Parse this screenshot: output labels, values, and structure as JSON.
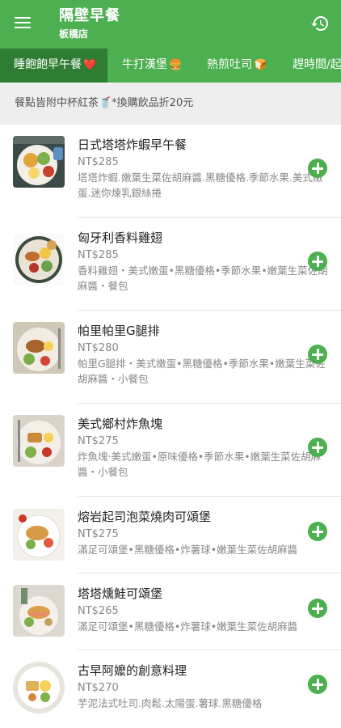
{
  "header": {
    "title": "隔壁早餐",
    "subtitle": "板橋店",
    "menu_icon": "hamburger-menu-icon",
    "history_icon": "history-icon"
  },
  "tabs": [
    {
      "label": "睡飽飽早午餐",
      "emoji": "❤️",
      "active": true
    },
    {
      "label": "牛打漢堡",
      "emoji": "🍔",
      "active": false
    },
    {
      "label": "熱煎吐司",
      "emoji": "🍞",
      "active": false
    },
    {
      "label": "趕時間/起",
      "emoji": "",
      "active": false
    }
  ],
  "notice": "餐點皆附中杯紅茶🥤*換購飲品折20元",
  "items": [
    {
      "name": "日式塔塔炸蝦早午餐",
      "price": "NT$285",
      "desc": "塔塔炸蝦.嫩葉生菜佐胡麻醬.黑糖優格.季節水果.美式嫩蛋.迷你煉乳銀絲捲"
    },
    {
      "name": "匈牙利香料雞翅",
      "price": "NT$285",
      "desc": "香料雞翅・美式嫩蛋•黑糖優格•季節水果•嫩葉生菜佐胡麻醬・餐包"
    },
    {
      "name": "帕里帕里G腿排",
      "price": "NT$280",
      "desc": "帕里G腿排・美式嫩蛋•黑糖優格•季節水果•嫩葉生菜佐胡麻醬・小餐包"
    },
    {
      "name": "美式鄉村炸魚塊",
      "price": "NT$275",
      "desc": "炸魚塊‧美式嫩蛋•原味優格•季節水果•嫩葉生菜佐胡麻醬・小餐包"
    },
    {
      "name": "熔岩起司泡菜燒肉可頌堡",
      "price": "NT$275",
      "desc": "滿足可頌堡•黑糖優格•炸薯球•嫩葉生菜佐胡麻醬"
    },
    {
      "name": "塔塔燻鮭可頌堡",
      "price": "NT$265",
      "desc": "滿足可頌堡•黑糖優格•炸薯球•嫩葉生菜佐胡麻醬"
    },
    {
      "name": "古早阿嬤的創意料理",
      "price": "NT$270",
      "desc": "芋泥法式吐司.肉鬆.太陽蛋.薯球.黑糖優格"
    }
  ],
  "colors": {
    "primary": "#4caf50",
    "active_tab": "#2e7d32",
    "notice_bg": "#eeeeee"
  }
}
